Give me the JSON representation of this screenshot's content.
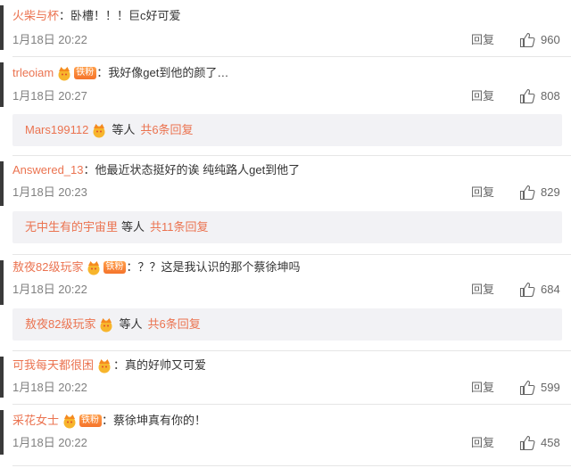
{
  "badge_label": "铁粉",
  "reply_label": "回复",
  "comments": [
    {
      "user": "火柴与杯",
      "text": "：卧槽！！！巨c好可爱",
      "time": "1月18日 20:22",
      "likes": "960"
    },
    {
      "user": "trleoiam",
      "text": "：我好像get到他的颜了…",
      "time": "1月18日 20:27",
      "likes": "808",
      "reply": {
        "user": "Mars199112",
        "text": "等人",
        "link": "共6条回复"
      }
    },
    {
      "user": "Answered_13",
      "text": "：他最近状态挺好的诶 纯纯路人get到他了",
      "time": "1月18日 20:23",
      "likes": "829",
      "reply": {
        "user": "无中生有的宇宙里",
        "text": "等人",
        "link": "共11条回复"
      }
    },
    {
      "user": "敖夜82级玩家",
      "text": "：？？这是我认识的那个蔡徐坤吗",
      "time": "1月18日 20:22",
      "likes": "684",
      "reply": {
        "user": "敖夜82级玩家",
        "text": "等人",
        "link": "共6条回复"
      }
    },
    {
      "user": "可我每天都很困",
      "text": "：真的好帅又可爱",
      "time": "1月18日 20:22",
      "likes": "599"
    },
    {
      "user": "采花女士",
      "text": "：蔡徐坤真有你的！",
      "time": "1月18日 20:22",
      "likes": "458"
    }
  ]
}
